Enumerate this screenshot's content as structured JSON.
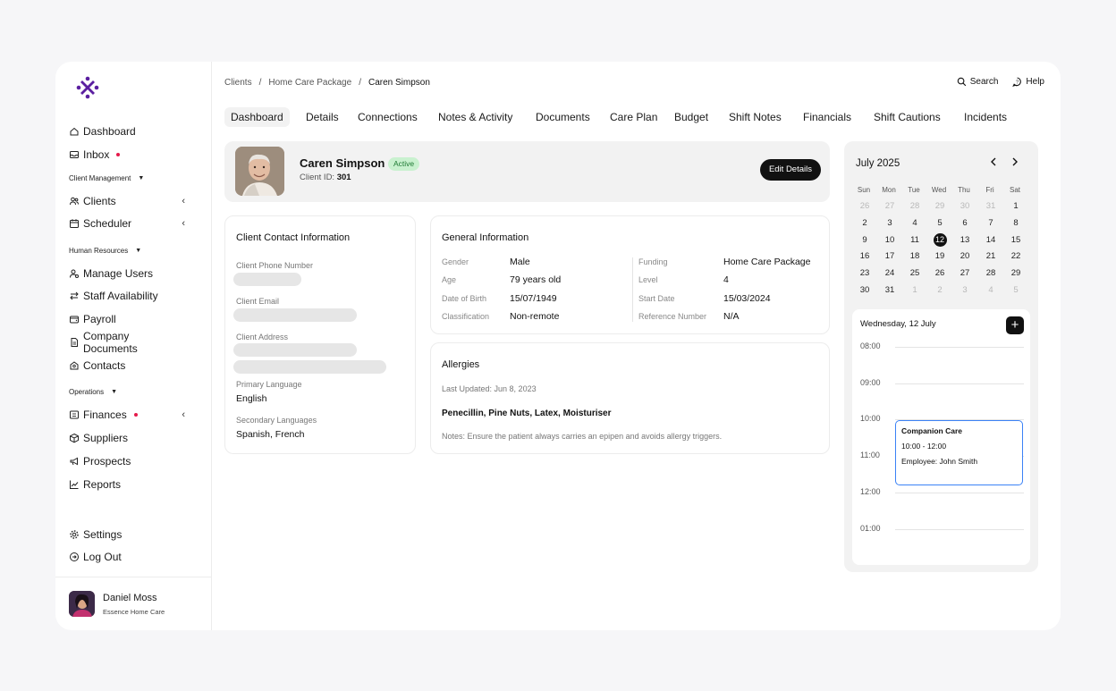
{
  "sidebar": {
    "items_main": [
      {
        "label": "Dashboard",
        "icon": "home-icon"
      },
      {
        "label": "Inbox",
        "icon": "inbox-icon",
        "dot": true
      }
    ],
    "section_client": "Client Management",
    "items_client": [
      {
        "label": "Clients",
        "icon": "users-icon"
      },
      {
        "label": "Scheduler",
        "icon": "calendar-icon"
      }
    ],
    "section_hr": "Human Resources",
    "items_hr": [
      {
        "label": "Manage Users",
        "icon": "user-cog-icon"
      },
      {
        "label": "Staff Availability",
        "icon": "swap-icon"
      },
      {
        "label": "Payroll",
        "icon": "wallet-icon"
      },
      {
        "label": "Company Documents",
        "icon": "document-icon"
      },
      {
        "label": "Contacts",
        "icon": "contacts-icon"
      }
    ],
    "section_ops": "Operations",
    "items_ops": [
      {
        "label": "Finances",
        "icon": "finance-icon",
        "dot": true
      },
      {
        "label": "Suppliers",
        "icon": "box-icon"
      },
      {
        "label": "Prospects",
        "icon": "megaphone-icon"
      },
      {
        "label": "Reports",
        "icon": "chart-line-icon"
      }
    ],
    "settings": "Settings",
    "logout": "Log Out",
    "user": {
      "name": "Daniel Moss",
      "org": "Essence Home Care"
    },
    "accent": "#5b1fa0"
  },
  "breadcrumb": {
    "items": [
      "Clients",
      "Home Care Package"
    ],
    "current": "Caren Simpson",
    "sep": "/"
  },
  "top_actions": {
    "search": "Search",
    "help": "Help"
  },
  "tabs": [
    "Dashboard",
    "Details",
    "Connections",
    "Notes & Activity",
    "Documents",
    "Care Plan",
    "Budget",
    "Shift Notes",
    "Financials",
    "Shift Cautions",
    "Incidents"
  ],
  "client": {
    "name": "Caren Simpson",
    "status": "Active",
    "id_label": "Client ID:",
    "id_value": "301",
    "edit_label": "Edit Details"
  },
  "contact": {
    "title": "Client Contact Information",
    "phone_label": "Client Phone Number",
    "email_label": "Client Email",
    "address_label": "Client Address",
    "primary_language_label": "Primary Language",
    "primary_language": "English",
    "secondary_languages_label": "Secondary Languages",
    "secondary_languages": "Spanish, French"
  },
  "general": {
    "title": "General Information",
    "left": [
      {
        "label": "Gender",
        "value": "Male"
      },
      {
        "label": "Age",
        "value": "79 years old"
      },
      {
        "label": "Date of Birth",
        "value": "15/07/1949"
      },
      {
        "label": "Classification",
        "value": "Non-remote"
      }
    ],
    "right": [
      {
        "label": "Funding",
        "value": "Home Care Package"
      },
      {
        "label": "Level",
        "value": "4"
      },
      {
        "label": "Start Date",
        "value": "15/03/2024"
      },
      {
        "label": "Reference Number",
        "value": "N/A"
      }
    ]
  },
  "allergies": {
    "title": "Allergies",
    "updated": "Last Updated: Jun 8, 2023",
    "list": "Penecillin, Pine Nuts, Latex, Moisturiser",
    "notes": "Notes: Ensure the patient always carries an epipen and avoids allergy triggers."
  },
  "calendar": {
    "month": "July 2025",
    "dow": [
      "Sun",
      "Mon",
      "Tue",
      "Wed",
      "Thu",
      "Fri",
      "Sat"
    ],
    "weeks": [
      [
        [
          "26",
          1
        ],
        [
          "27",
          1
        ],
        [
          "28",
          1
        ],
        [
          "29",
          1
        ],
        [
          "30",
          1
        ],
        [
          "31",
          1
        ],
        [
          "1",
          0
        ]
      ],
      [
        [
          "2",
          0
        ],
        [
          "3",
          0
        ],
        [
          "4",
          0
        ],
        [
          "5",
          0
        ],
        [
          "6",
          0
        ],
        [
          "7",
          0
        ],
        [
          "8",
          0
        ]
      ],
      [
        [
          "9",
          0
        ],
        [
          "10",
          0
        ],
        [
          "11",
          0
        ],
        [
          "12",
          2
        ],
        [
          "13",
          0
        ],
        [
          "14",
          0
        ],
        [
          "15",
          0
        ]
      ],
      [
        [
          "16",
          0
        ],
        [
          "17",
          0
        ],
        [
          "18",
          0
        ],
        [
          "19",
          0
        ],
        [
          "20",
          0
        ],
        [
          "21",
          0
        ],
        [
          "22",
          0
        ]
      ],
      [
        [
          "23",
          0
        ],
        [
          "24",
          0
        ],
        [
          "25",
          0
        ],
        [
          "26",
          0
        ],
        [
          "27",
          0
        ],
        [
          "28",
          0
        ],
        [
          "29",
          0
        ]
      ],
      [
        [
          "30",
          0
        ],
        [
          "31",
          0
        ],
        [
          "1",
          1
        ],
        [
          "2",
          1
        ],
        [
          "3",
          1
        ],
        [
          "4",
          1
        ],
        [
          "5",
          1
        ]
      ]
    ],
    "day_title": "Wednesday, 12 July",
    "times": [
      "08:00",
      "09:00",
      "10:00",
      "11:00",
      "12:00",
      "01:00"
    ],
    "event": {
      "title": "Companion Care",
      "time": "10:00 - 12:00",
      "employee": "Employee: John Smith"
    }
  }
}
